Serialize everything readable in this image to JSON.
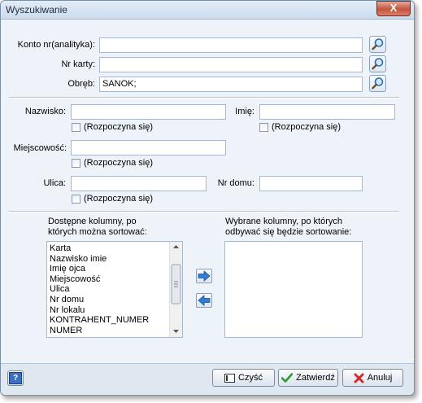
{
  "window": {
    "title": "Wyszukiwanie",
    "close": "X"
  },
  "lookup": {
    "konto_label": "Konto nr(analityka):",
    "konto_value": "",
    "karta_label": "Nr karty:",
    "karta_value": "",
    "obreb_label": "Obręb:",
    "obreb_value": "SANOK;"
  },
  "person": {
    "nazwisko_label": "Nazwisko:",
    "nazwisko_value": "",
    "imie_label": "Imię:",
    "imie_value": "",
    "starts_with": "(Rozpoczyna się)",
    "miejscowosc_label": "Miejscowość:",
    "miejscowosc_value": "",
    "ulica_label": "Ulica:",
    "ulica_value": "",
    "nr_domu_label": "Nr domu:",
    "nr_domu_value": ""
  },
  "sorting": {
    "available_header_line1": "Dostępne kolumny, po",
    "available_header_line2": "których można sortować:",
    "selected_header_line1": "Wybrane kolumny, po których",
    "selected_header_line2": "odbywać się będzie sortowanie:",
    "available_items": [
      "Karta",
      "Nazwisko imie",
      "Imię ojca",
      "Miejscowość",
      "Ulica",
      "Nr domu",
      "Nr lokalu",
      "KONTRAHENT_NUMER",
      "NUMER"
    ],
    "selected_items": []
  },
  "footer": {
    "help": "?",
    "clear": "Czyść",
    "approve": "Zatwierdź",
    "cancel": "Anuluj"
  }
}
